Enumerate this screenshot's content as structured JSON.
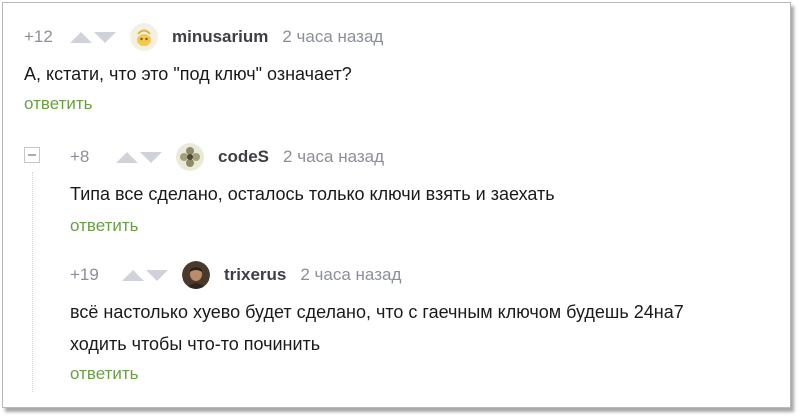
{
  "comments": [
    {
      "rating": "+12",
      "username": "minusarium",
      "time": "2 часа назад",
      "lines": [
        "А, кстати, что это \"под ключ\" означает?"
      ],
      "reply": "ответить",
      "avatar_icon": "yellow-face-avatar"
    },
    {
      "rating": "+8",
      "username": "codeS",
      "time": "2 часа назад",
      "lines": [
        "Типа все сделано, осталось только ключи взять и заехать"
      ],
      "reply": "ответить",
      "avatar_icon": "flower-avatar"
    },
    {
      "rating": "+19",
      "username": "trixerus",
      "time": "2 часа назад",
      "lines": [
        "всё настолько хуево будет сделано, что с гаечным ключом будешь 24на7",
        "ходить чтобы что-то починить"
      ],
      "reply": "ответить",
      "avatar_icon": "photo-avatar"
    }
  ],
  "colors": {
    "reply_link": "#6a9f44",
    "meta_text": "#8a8f99",
    "username": "#3d3f45",
    "vote_arrow": "#cfd3d9"
  }
}
